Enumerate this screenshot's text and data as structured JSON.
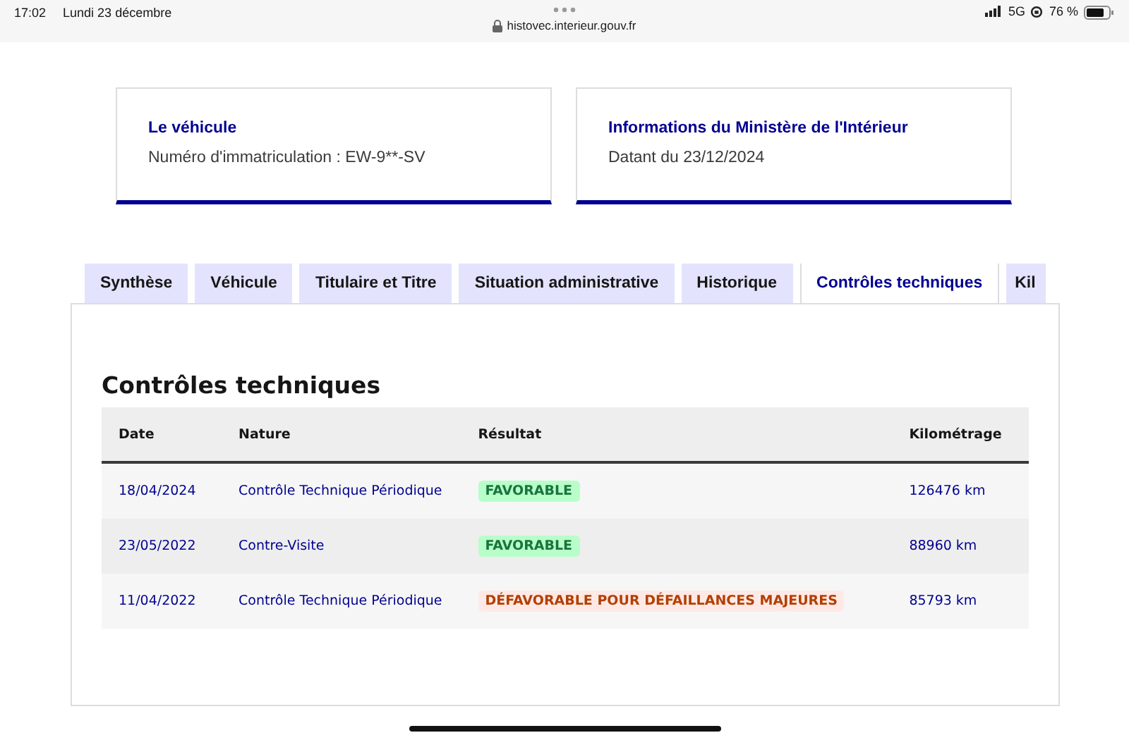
{
  "status_bar": {
    "time": "17:02",
    "date": "Lundi 23 décembre",
    "network": "5G",
    "battery": "76 %",
    "url": "histovec.interieur.gouv.fr"
  },
  "cards": [
    {
      "title": "Le véhicule",
      "text": "Numéro d'immatriculation : EW-9**-SV"
    },
    {
      "title": "Informations du Ministère de l'Intérieur",
      "text": "Datant du 23/12/2024"
    }
  ],
  "tabs": [
    {
      "label": "Synthèse",
      "selected": false
    },
    {
      "label": "Véhicule",
      "selected": false
    },
    {
      "label": "Titulaire et Titre",
      "selected": false
    },
    {
      "label": "Situation administrative",
      "selected": false
    },
    {
      "label": "Historique",
      "selected": false
    },
    {
      "label": "Contrôles techniques",
      "selected": true
    },
    {
      "label": "Kil",
      "selected": false
    }
  ],
  "section_title": "Contrôles techniques",
  "table": {
    "columns": [
      "Date",
      "Nature",
      "Résultat",
      "Kilométrage"
    ],
    "rows": [
      {
        "date": "18/04/2024",
        "nature": "Contrôle Technique Périodique",
        "result": "FAVORABLE",
        "kind": "success",
        "km": "126476 km"
      },
      {
        "date": "23/05/2022",
        "nature": "Contre-Visite",
        "result": "FAVORABLE",
        "kind": "success",
        "km": "88960 km"
      },
      {
        "date": "11/04/2022",
        "nature": "Contrôle Technique Périodique",
        "result": "DÉFAVORABLE POUR DÉFAILLANCES MAJEURES",
        "kind": "error",
        "km": "85793 km"
      }
    ]
  }
}
